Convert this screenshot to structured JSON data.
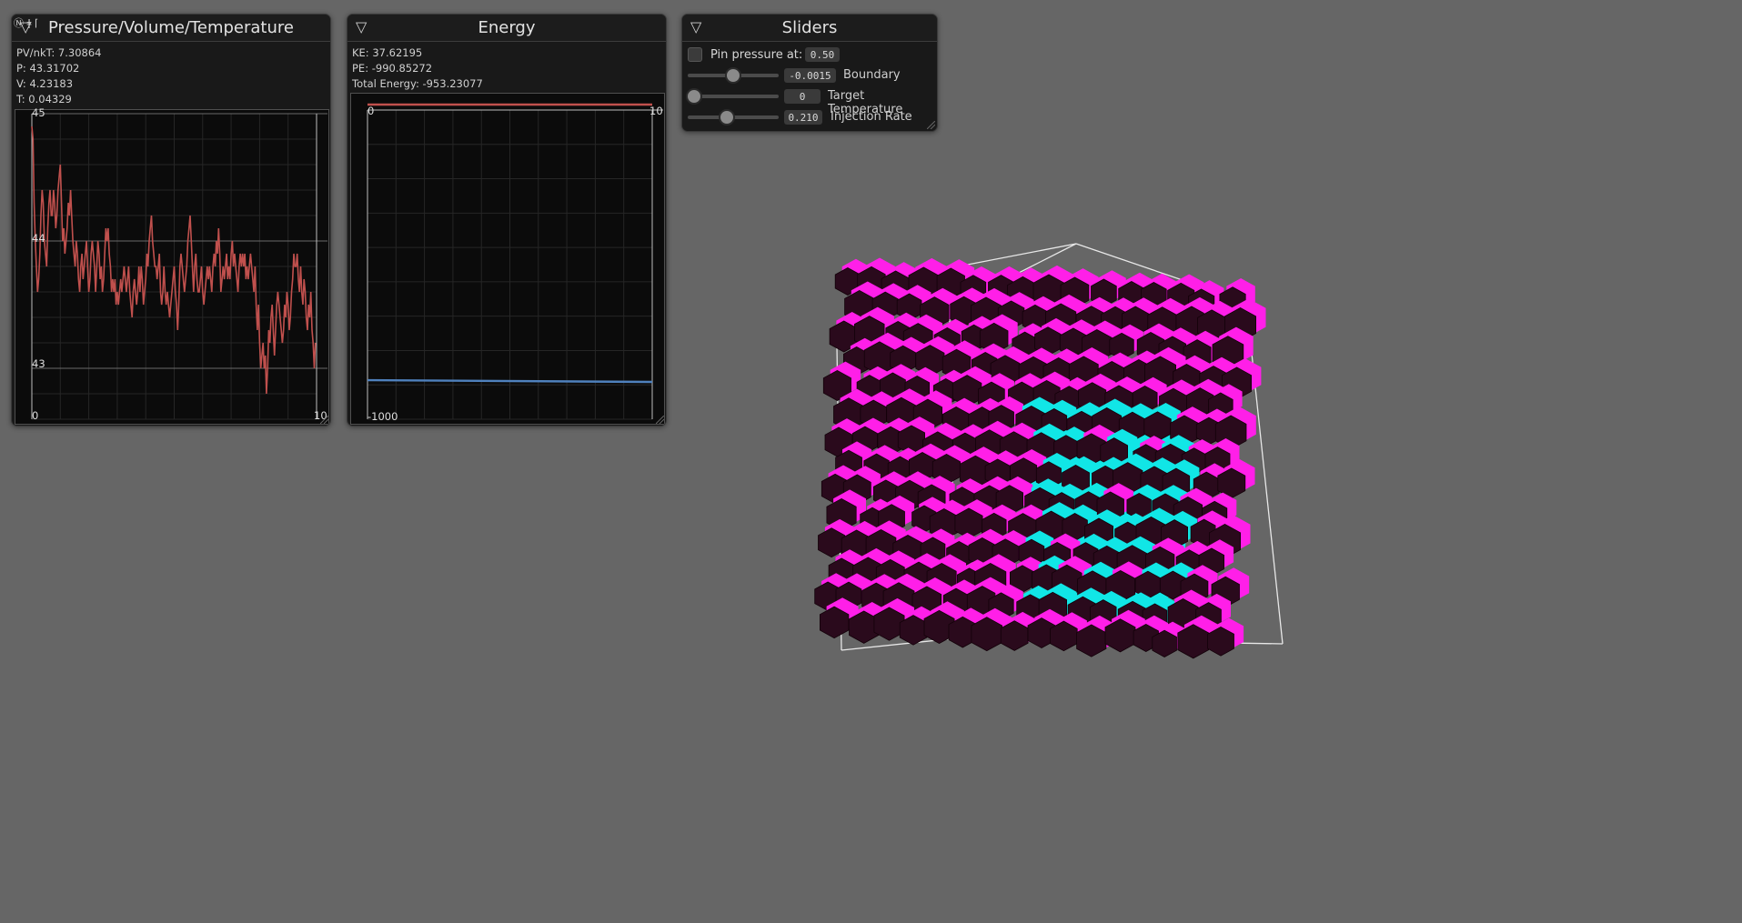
{
  "pvt": {
    "title": "Pressure/Volume/Temperature",
    "corner_glyph": "Ⓝ ǂ ⌈",
    "stats": [
      "PV/nkT: 7.30864",
      "P: 43.31702",
      "V: 4.23183",
      "T: 0.04329"
    ],
    "y_labels": [
      "45",
      "44",
      "43"
    ],
    "x_labels": [
      "0",
      "10"
    ],
    "color": "#c0504d",
    "chart_data": {
      "type": "line",
      "xlim": [
        0,
        10
      ],
      "ylim": [
        42.6,
        45
      ],
      "x": [
        0,
        0.04,
        0.08,
        0.12,
        0.16,
        0.2,
        0.24,
        0.28,
        0.32,
        0.36,
        0.4,
        0.44,
        0.48,
        0.52,
        0.56,
        0.6,
        0.64,
        0.68,
        0.72,
        0.76,
        0.8,
        0.84,
        0.88,
        0.92,
        0.96,
        1,
        1.04,
        1.08,
        1.12,
        1.16,
        1.2,
        1.24,
        1.28,
        1.32,
        1.36,
        1.4,
        1.44,
        1.48,
        1.52,
        1.56,
        1.6,
        1.64,
        1.68,
        1.72,
        1.76,
        1.8,
        1.84,
        1.88,
        1.92,
        1.96,
        2,
        2.04,
        2.08,
        2.12,
        2.16,
        2.2,
        2.24,
        2.28,
        2.32,
        2.36,
        2.4,
        2.44,
        2.48,
        2.52,
        2.56,
        2.6,
        2.64,
        2.68,
        2.72,
        2.76,
        2.8,
        2.84,
        2.88,
        2.92,
        2.96,
        3,
        3.04,
        3.08,
        3.12,
        3.16,
        3.2,
        3.24,
        3.28,
        3.32,
        3.36,
        3.4,
        3.44,
        3.48,
        3.52,
        3.56,
        3.6,
        3.64,
        3.68,
        3.72,
        3.76,
        3.8,
        3.84,
        3.88,
        3.92,
        3.96,
        4,
        4.04,
        4.08,
        4.12,
        4.16,
        4.2,
        4.24,
        4.28,
        4.32,
        4.36,
        4.4,
        4.44,
        4.48,
        4.52,
        4.56,
        4.6,
        4.64,
        4.68,
        4.72,
        4.76,
        4.8,
        4.84,
        4.88,
        4.92,
        4.96,
        5,
        5.04,
        5.08,
        5.12,
        5.16,
        5.2,
        5.24,
        5.28,
        5.32,
        5.36,
        5.4,
        5.44,
        5.48,
        5.52,
        5.56,
        5.6,
        5.64,
        5.68,
        5.72,
        5.76,
        5.8,
        5.84,
        5.88,
        5.92,
        5.96,
        6,
        6.04,
        6.08,
        6.12,
        6.16,
        6.2,
        6.24,
        6.28,
        6.32,
        6.36,
        6.4,
        6.44,
        6.48,
        6.52,
        6.56,
        6.6,
        6.64,
        6.68,
        6.72,
        6.76,
        6.8,
        6.84,
        6.88,
        6.92,
        6.96,
        7,
        7.04,
        7.08,
        7.12,
        7.16,
        7.2,
        7.24,
        7.28,
        7.32,
        7.36,
        7.4,
        7.44,
        7.48,
        7.52,
        7.56,
        7.6,
        7.64,
        7.68,
        7.72,
        7.76,
        7.8,
        7.84,
        7.88,
        7.92,
        7.96,
        8,
        8.04,
        8.08,
        8.12,
        8.16,
        8.2,
        8.24,
        8.28,
        8.32,
        8.36,
        8.4,
        8.44,
        8.48,
        8.52,
        8.56,
        8.6,
        8.64,
        8.68,
        8.72,
        8.76,
        8.8,
        8.84,
        8.88,
        8.92,
        8.96,
        9,
        9.04,
        9.08,
        9.12,
        9.16,
        9.2,
        9.24,
        9.28,
        9.32,
        9.36,
        9.4,
        9.44,
        9.48,
        9.52,
        9.56,
        9.6,
        9.64,
        9.68,
        9.72,
        9.76,
        9.8,
        9.84,
        9.88,
        9.92,
        9.96
      ],
      "y": [
        44.9,
        44.8,
        44.3,
        44.0,
        43.8,
        43.6,
        43.7,
        43.9,
        44.2,
        44.4,
        44.3,
        44.0,
        43.9,
        43.8,
        44.1,
        44.3,
        44.4,
        44.2,
        44.2,
        44.4,
        44.3,
        44.1,
        44.2,
        44.4,
        44.5,
        44.6,
        44.3,
        44.0,
        44.1,
        43.9,
        44.0,
        44.1,
        44.3,
        44.2,
        44.4,
        44.2,
        44.0,
        43.9,
        43.8,
        44.0,
        43.9,
        43.7,
        43.6,
        43.8,
        43.9,
        43.7,
        43.8,
        43.9,
        44.0,
        43.8,
        43.6,
        43.7,
        43.9,
        44.0,
        43.9,
        43.8,
        43.6,
        43.8,
        44.0,
        43.9,
        43.7,
        43.8,
        43.6,
        43.7,
        43.9,
        44.1,
        44.0,
        44.1,
        43.9,
        43.8,
        43.6,
        43.7,
        43.6,
        43.7,
        43.5,
        43.6,
        43.5,
        43.6,
        43.7,
        43.6,
        43.7,
        43.8,
        43.7,
        43.6,
        43.7,
        43.8,
        43.6,
        43.5,
        43.4,
        43.6,
        43.7,
        43.6,
        43.5,
        43.6,
        43.8,
        43.6,
        43.8,
        43.7,
        43.5,
        43.6,
        43.7,
        43.9,
        43.8,
        44.0,
        44.1,
        44.2,
        44.0,
        43.9,
        43.8,
        43.8,
        43.7,
        43.8,
        43.9,
        43.6,
        43.5,
        43.6,
        43.8,
        43.6,
        43.5,
        43.6,
        43.5,
        43.4,
        43.5,
        43.6,
        43.7,
        43.8,
        43.6,
        43.5,
        43.3,
        43.5,
        43.8,
        43.9,
        43.8,
        43.7,
        43.6,
        43.7,
        43.8,
        44.0,
        44.1,
        44.2,
        44.0,
        43.8,
        43.6,
        43.8,
        43.9,
        43.7,
        43.6,
        43.6,
        43.7,
        43.8,
        43.6,
        43.5,
        43.6,
        43.7,
        43.8,
        43.7,
        43.8,
        43.7,
        43.6,
        43.8,
        43.9,
        43.8,
        44.0,
        43.9,
        44.1,
        43.9,
        43.6,
        43.7,
        43.8,
        43.7,
        43.8,
        43.9,
        43.7,
        43.8,
        43.7,
        43.9,
        44.0,
        43.8,
        43.9,
        43.8,
        43.7,
        43.6,
        43.8,
        43.9,
        43.8,
        43.9,
        43.8,
        43.9,
        43.7,
        43.8,
        43.7,
        43.8,
        43.9,
        43.8,
        43.7,
        43.6,
        43.8,
        43.5,
        43.3,
        43.5,
        43.2,
        43.0,
        43.1,
        43.2,
        43.0,
        43.1,
        42.8,
        43.0,
        43.3,
        43.2,
        43.4,
        43.5,
        43.3,
        43.1,
        43.3,
        43.5,
        43.6,
        43.5,
        43.4,
        43.3,
        43.2,
        43.3,
        43.5,
        43.4,
        43.6,
        43.5,
        43.3,
        43.4,
        43.6,
        43.7,
        43.9,
        43.8,
        43.8,
        43.9,
        43.7,
        43.6,
        43.8,
        43.6,
        43.5,
        43.7,
        43.6,
        43.4,
        43.3,
        43.5,
        43.4,
        43.6,
        43.3,
        43.2,
        43.0,
        43.2,
        43.4,
        43.3,
        43.2,
        43.4
      ]
    }
  },
  "energy": {
    "title": "Energy",
    "stats": [
      "KE: 37.62195",
      "PE: -990.85272",
      "Total Energy: -953.23077"
    ],
    "labels": {
      "zero": "0",
      "ten": "10",
      "min": "-1000"
    },
    "chart_data": {
      "type": "line",
      "xlim": [
        0,
        10
      ],
      "ylim": [
        -1010,
        60
      ],
      "series": [
        {
          "color": "#c0504d",
          "x": [
            0,
            10
          ],
          "y": [
            37.8,
            37.6
          ]
        },
        {
          "color": "#4f81bd",
          "x": [
            0,
            10
          ],
          "y": [
            -985,
            -991
          ]
        }
      ]
    }
  },
  "sliders": {
    "title": "Sliders",
    "pin_label": "Pin pressure at:",
    "pin_value": "0.50",
    "rows": [
      {
        "value": "-0.0015",
        "label": "Boundary",
        "position": 0.5
      },
      {
        "value": "0",
        "label": "Target Temperature",
        "position": 0.0
      },
      {
        "value": "0.210",
        "label": "Injection Rate",
        "position": 0.42
      }
    ]
  },
  "scene": {
    "colors": {
      "magenta": "#ff1fe8",
      "cyan": "#11e6e6",
      "dark": "#2a0a1c"
    }
  }
}
